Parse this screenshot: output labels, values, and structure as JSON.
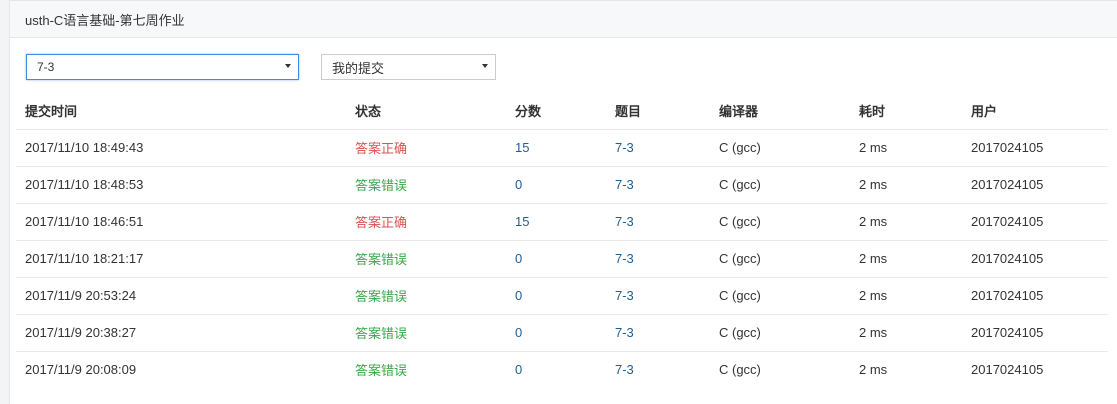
{
  "header": {
    "title": "usth-C语言基础-第七周作业"
  },
  "filters": {
    "problem_value": "7-3",
    "scope_value": "我的提交"
  },
  "table": {
    "columns": [
      "提交时间",
      "状态",
      "分数",
      "题目",
      "编译器",
      "耗时",
      "用户"
    ],
    "rows": [
      {
        "time": "2017/11/10 18:49:43",
        "status": "答案正确",
        "status_kind": "ok",
        "score": "15",
        "problem": "7-3",
        "compiler": "C (gcc)",
        "cost": "2 ms",
        "user": "2017024105"
      },
      {
        "time": "2017/11/10 18:48:53",
        "status": "答案错误",
        "status_kind": "err",
        "score": "0",
        "problem": "7-3",
        "compiler": "C (gcc)",
        "cost": "2 ms",
        "user": "2017024105"
      },
      {
        "time": "2017/11/10 18:46:51",
        "status": "答案正确",
        "status_kind": "ok",
        "score": "15",
        "problem": "7-3",
        "compiler": "C (gcc)",
        "cost": "2 ms",
        "user": "2017024105"
      },
      {
        "time": "2017/11/10 18:21:17",
        "status": "答案错误",
        "status_kind": "err",
        "score": "0",
        "problem": "7-3",
        "compiler": "C (gcc)",
        "cost": "2 ms",
        "user": "2017024105"
      },
      {
        "time": "2017/11/9 20:53:24",
        "status": "答案错误",
        "status_kind": "err",
        "score": "0",
        "problem": "7-3",
        "compiler": "C (gcc)",
        "cost": "2 ms",
        "user": "2017024105"
      },
      {
        "time": "2017/11/9 20:38:27",
        "status": "答案错误",
        "status_kind": "err",
        "score": "0",
        "problem": "7-3",
        "compiler": "C (gcc)",
        "cost": "2 ms",
        "user": "2017024105"
      },
      {
        "time": "2017/11/9 20:08:09",
        "status": "答案错误",
        "status_kind": "err",
        "score": "0",
        "problem": "7-3",
        "compiler": "C (gcc)",
        "cost": "2 ms",
        "user": "2017024105"
      }
    ]
  },
  "colors": {
    "status_ok": "#d9534f",
    "status_err": "#3aa84a",
    "link": "#1f5e93",
    "focus_border": "#3a8ee6"
  }
}
